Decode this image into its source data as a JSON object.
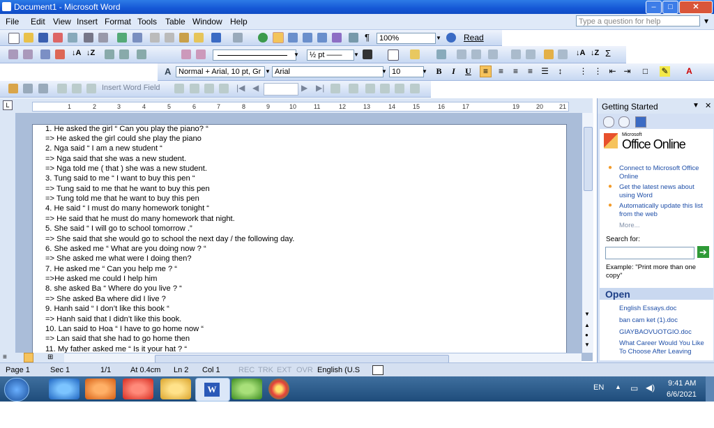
{
  "window": {
    "title": "Document1 - Microsoft Word"
  },
  "menubar": {
    "items": [
      "File",
      "Edit",
      "View",
      "Insert",
      "Format",
      "Tools",
      "Table",
      "Window",
      "Help"
    ],
    "help_placeholder": "Type a question for help"
  },
  "toolbar": {
    "zoom": "100%",
    "read_label": "Read",
    "line_weight": "½ pt",
    "style": "Normal + Arial, 10 pt, Gr",
    "font": "Arial",
    "size": "10",
    "bold": "B",
    "italic": "I",
    "underline": "U",
    "insert_word_field": "Insert Word Field"
  },
  "ruler": {
    "numbers": [
      "1",
      "2",
      "3",
      "4",
      "5",
      "6",
      "7",
      "8",
      "9",
      "10",
      "11",
      "12",
      "13",
      "14",
      "15",
      "16",
      "17",
      "19",
      "20",
      "21"
    ]
  },
  "document": {
    "lines": [
      "1. He asked the girl “ Can you play the piano? “",
      "=> He asked the girl could she play the piano",
      "2. Nga said “ I am a new student “",
      "=> Nga said that she was a new student.",
      "=> Nga told me ( that ) she was a new student.",
      "3. Tung said to me “ I want to buy this pen “",
      "=> Tung said to me that he want to buy this pen",
      "=> Tung told me that he want to buy this pen",
      "4. He said “ I must do many homework tonight “",
      "=> He said that he must do many homework that night.",
      "5. She said “ I will go to school tomorrow .”",
      "=> She said that she would go to school the next day / the following day.",
      "6. She asked me “ What are you doing now ? “",
      "=> She asked me  what were I doing then?",
      "7. He asked me “ Can you help me ? “",
      "=>He asked me could I help him",
      "8. she asked Ba “ Where do you live ? “",
      "=> She asked Ba where did I live ?",
      "9.  Hanh said “ I don’t like this book “",
      "=> Hanh said that I didn’t like this book.",
      "10. Lan said to Hoa “ I have to go home now “",
      "=> Lan said that she had to go home then",
      "11. My father asked me “ Is it your hat ? “"
    ]
  },
  "taskpane": {
    "title": "Getting Started",
    "brand": "Office Online",
    "brand_small": "Microsoft",
    "links": [
      "Connect to Microsoft Office Online",
      "Get the latest news about using Word",
      "Automatically update this list from the web"
    ],
    "more": "More...",
    "search_label": "Search for:",
    "example": "Example:  \"Print more than one copy\"",
    "open_title": "Open",
    "open_files": [
      "English Essays.doc",
      "ban cam ket (1).doc",
      "GIAYBAOVUOTGIO.doc",
      "What Career Would You Like To Choose After Leaving"
    ]
  },
  "statusbar": {
    "page": "Page 1",
    "sec": "Sec 1",
    "pages": "1/1",
    "at": "At 0.4cm",
    "ln": "Ln 2",
    "col": "Col 1",
    "rec": "REC",
    "trk": "TRK",
    "ext": "EXT",
    "ovr": "OVR",
    "language": "English (U.S"
  },
  "taskbar": {
    "lang": "EN",
    "time": "9:41 AM",
    "date": "6/6/2021"
  },
  "colors": {
    "titlebar": "#1557d6",
    "menubar": "#dfe9f8",
    "taskbar": "#1e4c7b",
    "link": "#1f4fa8"
  }
}
